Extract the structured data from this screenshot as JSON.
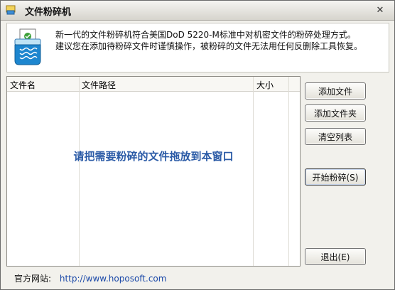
{
  "window": {
    "title": "文件粉碎机"
  },
  "intro": {
    "line1": "新一代的文件粉碎机符合美国DoD 5220-M标准中对机密文件的粉碎处理方式。",
    "line2": "建议您在添加待粉碎文件时谨慎操作，被粉碎的文件无法用任何反删除工具恢复。"
  },
  "file_list": {
    "columns": [
      "文件名",
      "文件路径",
      "大小"
    ],
    "drop_hint": "请把需要粉碎的文件拖放到本窗口"
  },
  "buttons": {
    "add_file": "添加文件",
    "add_folder": "添加文件夹",
    "clear_list": "清空列表",
    "start": "开始粉碎(S)",
    "exit": "退出(E)"
  },
  "footer": {
    "site_label": "官方网站:",
    "site_url": "http://www.hoposoft.com"
  },
  "icons": {
    "app": "shredder-app-icon",
    "hero": "shredder-icon",
    "close": "close-icon"
  }
}
